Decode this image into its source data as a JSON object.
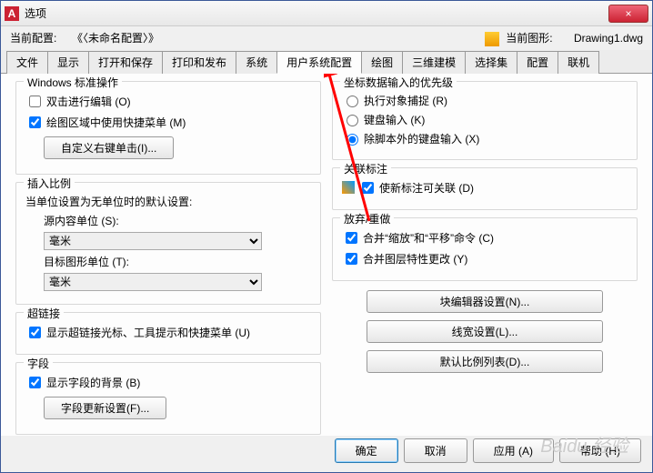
{
  "window": {
    "title": "选项"
  },
  "close_x": "×",
  "toprow": {
    "current_config_label": "当前配置:",
    "current_config_value": "《〈未命名配置〉》",
    "current_drawing_label": "当前图形:",
    "current_drawing_value": "Drawing1.dwg"
  },
  "tabs": [
    "文件",
    "显示",
    "打开和保存",
    "打印和发布",
    "系统",
    "用户系统配置",
    "绘图",
    "三维建模",
    "选择集",
    "配置",
    "联机"
  ],
  "active_tab_index": 5,
  "left": {
    "win_std": {
      "title": "Windows 标准操作",
      "dbl_click": "双击进行编辑 (O)",
      "shortcut_menu": "绘图区域中使用快捷菜单 (M)",
      "customize_btn": "自定义右键单击(I)..."
    },
    "insert_scale": {
      "title": "插入比例",
      "desc": "当单位设置为无单位时的默认设置:",
      "src_label": "源内容单位 (S):",
      "src_value": "毫米",
      "tgt_label": "目标图形单位 (T):",
      "tgt_value": "毫米"
    },
    "hyperlink": {
      "title": "超链接",
      "show": "显示超链接光标、工具提示和快捷菜单 (U)"
    },
    "field": {
      "title": "字段",
      "bg": "显示字段的背景 (B)",
      "update_btn": "字段更新设置(F)..."
    }
  },
  "right": {
    "coord": {
      "title": "坐标数据输入的优先级",
      "r1": "执行对象捕捉 (R)",
      "r2": "键盘输入 (K)",
      "r3": "除脚本外的键盘输入 (X)"
    },
    "assoc": {
      "title": "关联标注",
      "chk": "使新标注可关联 (D)"
    },
    "undo": {
      "title": "放弃/重做",
      "c1": "合并“缩放”和“平移”命令 (C)",
      "c2": "合并图层特性更改 (Y)"
    },
    "buttons": {
      "block_editor": "块编辑器设置(N)...",
      "lineweight": "线宽设置(L)...",
      "default_scale": "默认比例列表(D)..."
    }
  },
  "footer": {
    "ok": "确定",
    "cancel": "取消",
    "apply": "应用 (A)",
    "help": "帮助 (H)"
  },
  "watermark": "Baidu 经验"
}
